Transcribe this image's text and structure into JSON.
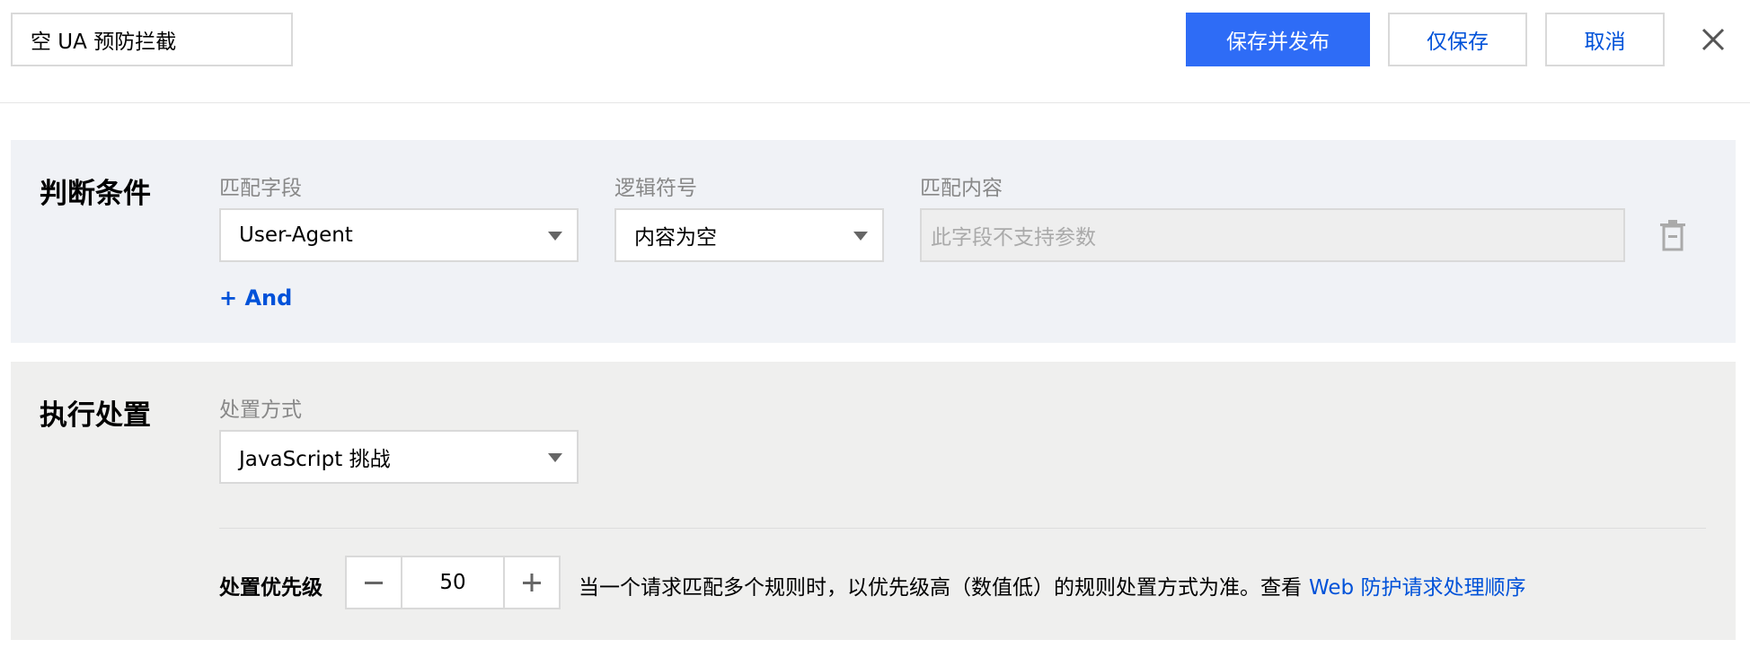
{
  "header": {
    "rule_name": "空 UA 预防拦截",
    "publish_label": "保存并发布",
    "save_label": "仅保存",
    "cancel_label": "取消"
  },
  "condition": {
    "title": "判断条件",
    "match_field_label": "匹配字段",
    "match_field_value": "User-Agent",
    "logic_label": "逻辑符号",
    "logic_value": "内容为空",
    "content_label": "匹配内容",
    "content_placeholder": "此字段不支持参数",
    "add_and_label": "+ And"
  },
  "action": {
    "title": "执行处置",
    "method_label": "处置方式",
    "method_value": "JavaScript 挑战",
    "priority_label": "处置优先级",
    "priority_value": "50",
    "priority_desc": "当一个请求匹配多个规则时，以优先级高（数值低）的规则处置方式为准。查看",
    "priority_link": "Web 防护请求处理顺序"
  },
  "colors": {
    "primary": "#2e6cf6",
    "link": "#0052d9"
  }
}
